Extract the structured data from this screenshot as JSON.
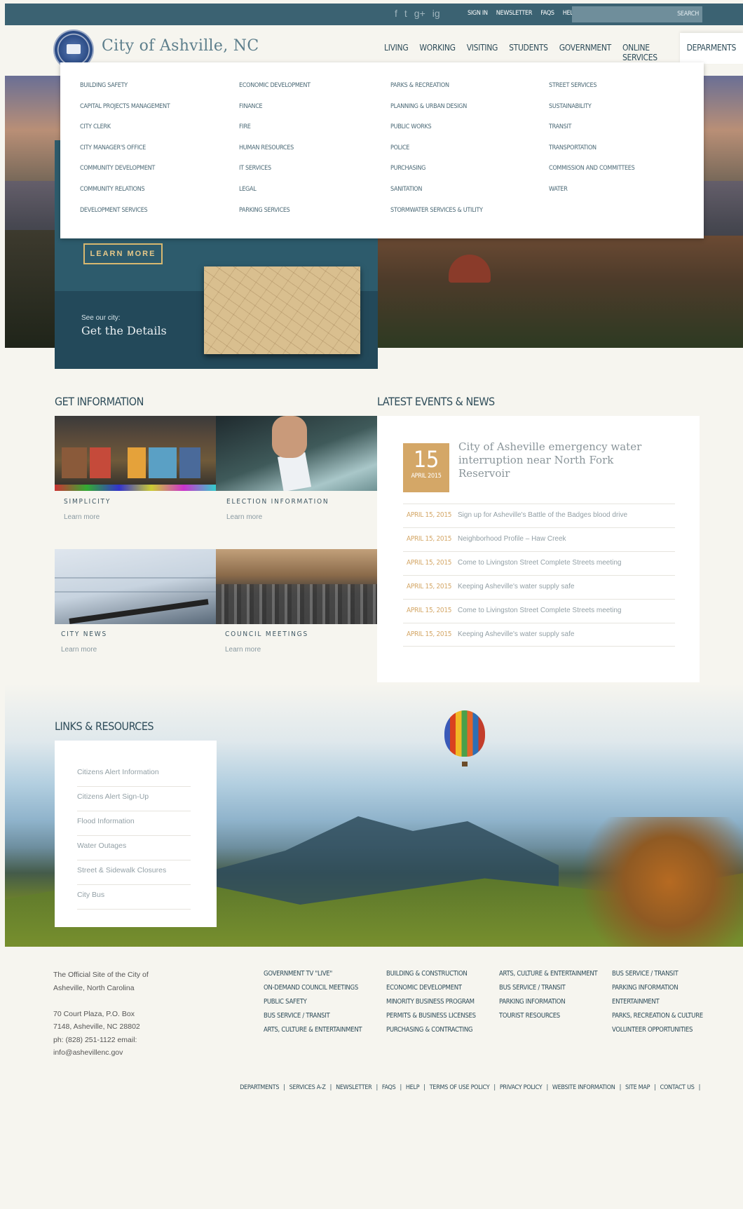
{
  "topbar": {
    "social": [
      "f",
      "t",
      "g+",
      "ig"
    ],
    "links": [
      "SIGN IN",
      "NEWSLETTER",
      "FAQS",
      "HELP"
    ],
    "search_label": "SEARCH"
  },
  "header": {
    "city_name": "City of Ashville, NC",
    "nav": [
      "LIVING",
      "WORKING",
      "VISITING",
      "STUDENTS",
      "GOVERNMENT",
      "ONLINE SERVICES",
      "DEPARMENTS"
    ]
  },
  "megamenu": {
    "columns": [
      [
        "BUILDING SAFETY",
        "CAPITAL PROJECTS MANAGEMENT",
        "CITY CLERK",
        "CITY MANAGER'S OFFICE",
        "COMMUNITY DEVELOPMENT",
        "COMMUNITY RELATIONS",
        "DEVELOPMENT SERVICES"
      ],
      [
        "ECONOMIC DEVELOPMENT",
        "FINANCE",
        "FIRE",
        "HUMAN RESOURCES",
        "IT SERVICES",
        "LEGAL",
        "PARKING SERVICES"
      ],
      [
        "PARKS & RECREATION",
        "PLANNING & URBAN DESIGN",
        "PUBLIC WORKS",
        "POLICE",
        "PURCHASING",
        "SANITATION",
        "STORMWATER SERVICES & UTILITY"
      ],
      [
        "STREET SERVICES",
        "SUSTAINABILITY",
        "TRANSIT",
        "TRANSPORTATION",
        "COMMISSION AND COMMITTEES",
        "WATER"
      ]
    ]
  },
  "hero": {
    "learn_more": "LEARN MORE",
    "see_city": "See our city:",
    "get_details": "Get the Details"
  },
  "get_information": {
    "heading": "GET INFORMATION",
    "tiles": [
      {
        "title": "SIMPLICITY",
        "more": "Learn more"
      },
      {
        "title": "ELECTION INFORMATION",
        "more": "Learn more"
      },
      {
        "title": "CITY NEWS",
        "more": "Learn more"
      },
      {
        "title": "COUNCIL MEETINGS",
        "more": "Learn more"
      }
    ]
  },
  "events": {
    "heading": "LATEST EVENTS & NEWS",
    "featured": {
      "day": "15",
      "month": "APRIL 2015",
      "title": "City of Asheville emergency water interruption near North Fork Reservoir"
    },
    "items": [
      {
        "date": "APRIL 15, 2015",
        "title": "Sign up for Asheville's Battle of the Badges blood drive"
      },
      {
        "date": "APRIL 15, 2015",
        "title": "Neighborhood Profile – Haw Creek"
      },
      {
        "date": "APRIL 15, 2015",
        "title": "Come to Livingston Street Complete Streets meeting"
      },
      {
        "date": "APRIL 15, 2015",
        "title": "Keeping Asheville's water supply safe"
      },
      {
        "date": "APRIL 15, 2015",
        "title": "Come to Livingston Street Complete Streets meeting"
      },
      {
        "date": "APRIL 15, 2015",
        "title": "Keeping Asheville's water supply safe"
      }
    ]
  },
  "links_resources": {
    "heading": "LINKS & RESOURCES",
    "items": [
      "Citizens Alert Information",
      "Citizens Alert Sign-Up",
      "Flood Information",
      "Water Outages",
      "Street & Sidewalk Closures",
      "City Bus"
    ]
  },
  "footer": {
    "about": [
      "The Official Site of the City of",
      "Asheville, North Carolina",
      "",
      "70 Court Plaza, P.O. Box",
      "7148, Asheville, NC 28802",
      "ph: (828) 251-1122   email:",
      "info@ashevillenc.gov"
    ],
    "columns": [
      [
        "GOVERNMENT TV \"LIVE\"",
        "ON-DEMAND COUNCIL MEETINGS",
        "PUBLIC SAFETY",
        "BUS SERVICE / TRANSIT",
        "ARTS, CULTURE & ENTERTAINMENT"
      ],
      [
        "BUILDING & CONSTRUCTION",
        "ECONOMIC DEVELOPMENT",
        "MINORITY BUSINESS PROGRAM",
        "PERMITS & BUSINESS LICENSES",
        "PURCHASING & CONTRACTING"
      ],
      [
        "ARTS, CULTURE & ENTERTAINMENT",
        "BUS SERVICE / TRANSIT",
        "PARKING INFORMATION",
        "TOURIST RESOURCES"
      ],
      [
        "BUS SERVICE / TRANSIT",
        "PARKING INFORMATION",
        "ENTERTAINMENT",
        "PARKS, RECREATION & CULTURE",
        "VOLUNTEER OPPORTUNITIES"
      ]
    ],
    "bottom_links": [
      "DEPARTMENTS",
      "SERVICES A-Z",
      "NEWSLETTER",
      "FAQS",
      "HELP",
      "TERMS OF USE POLICY",
      "PRIVACY POLICY",
      "WEBSITE INFORMATION",
      "SITE MAP",
      "CONTACT US"
    ]
  }
}
